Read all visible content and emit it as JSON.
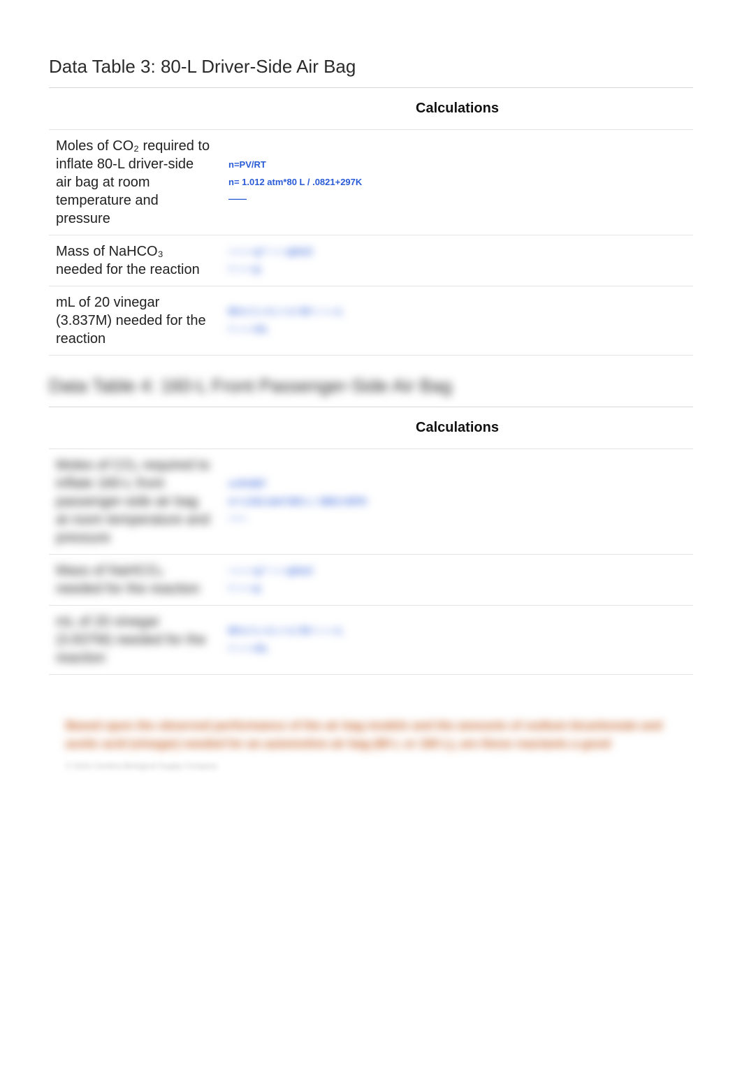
{
  "table3": {
    "title": "Data Table 3: 80-L Driver-Side Air Bag",
    "header_blank": "",
    "header_calc": "Calculations",
    "rows": [
      {
        "label": "Moles of CO₂ required to inflate 80-L driver-side air bag at room temperature and pressure",
        "calc": "n=PV/RT\nn= 1.012 atm*80 L / .0821+297K\n——"
      },
      {
        "label": "Mass of NaHCO₃ needed for the reaction",
        "calc": "———g * ——g/mol\n= ——g"
      },
      {
        "label": "mL of 20  vinegar (3.837M) needed for the reaction",
        "calc": "M=n / L  ⇒  L = n / M = ——L\n= ——mL"
      }
    ]
  },
  "table4": {
    "title": "Data Table 4: 160-L Front Passenger-Side Air Bag",
    "header_blank": "",
    "header_calc": "Calculations",
    "rows": [
      {
        "label": "Moles of CO₂ required to inflate 160-L front passenger-side air bag at room temperature and pressure",
        "calc": "n=PV/RT\nn= 1.012 atm*160 L / .0821+297K\n——"
      },
      {
        "label": "Mass of NaHCO₃ needed for the reaction",
        "calc": "———g * ——g/mol\n= ——g"
      },
      {
        "label": "mL of 20  vinegar (3.837M) needed for the reaction",
        "calc": "M=n / L  ⇒  L = n / M = ——L\n= ——mL"
      }
    ]
  },
  "prompt": {
    "text": "Based upon the observed performance of the air bag models and the amounts of sodium bicarbonate and acetic acid (vinegar) needed for an automotive air bag (80 L or 160 L), are these reactants a good",
    "fine": "© 2016 Carolina Biological Supply Company"
  }
}
